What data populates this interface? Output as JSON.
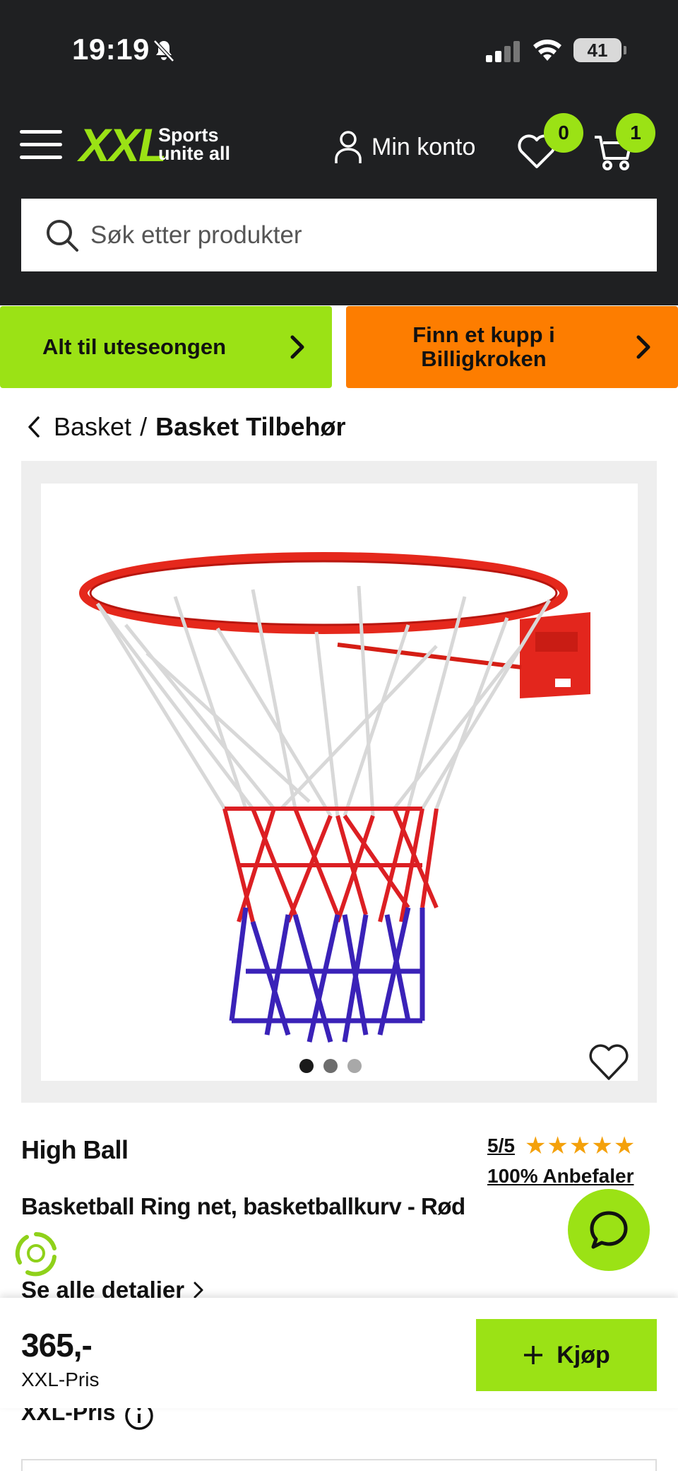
{
  "status_bar": {
    "time": "19:19",
    "battery": "41",
    "icons": [
      "bell-muted-icon",
      "signal-icon",
      "wifi-icon",
      "battery-icon"
    ]
  },
  "header": {
    "logo_text": "XXL",
    "logo_tagline_1": "Sports",
    "logo_tagline_2": "unite all",
    "account_label": "Min konto",
    "wishlist_count": "0",
    "cart_count": "1",
    "search_placeholder": "Søk etter produkter"
  },
  "promos": [
    {
      "label": "Alt til uteseongen",
      "color": "#9be215"
    },
    {
      "label": "Finn et kupp i Billigkroken",
      "color": "#fd7d00"
    }
  ],
  "breadcrumb": {
    "parent": "Basket",
    "separator": "/",
    "current": "Basket Tilbehør"
  },
  "gallery": {
    "image_count": 3,
    "active_index": 0
  },
  "product": {
    "brand": "High Ball",
    "rating": "5/5",
    "stars": 5,
    "recommend": "100% Anbefaler",
    "name": "Basketball Ring net, basketballkurv - Rød",
    "details_link": "Se alle detalier"
  },
  "sticky": {
    "price": "365,-",
    "price_label": "XXL-Pris",
    "buy_label": "Kjøp"
  },
  "below": {
    "price_label": "XXL-Pris"
  },
  "colors": {
    "accent_green": "#9be215",
    "accent_orange": "#fd7d00",
    "header_dark": "#1f2022",
    "star": "#f4a10b"
  }
}
